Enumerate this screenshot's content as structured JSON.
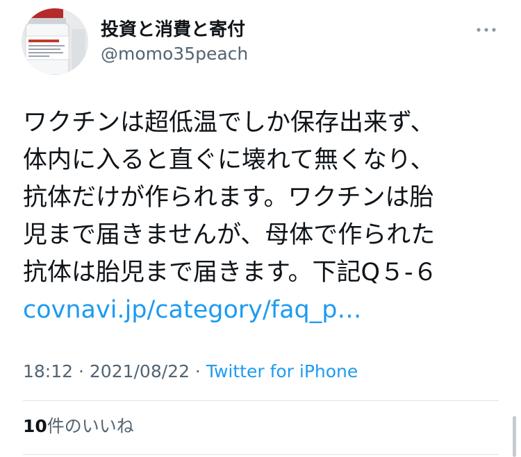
{
  "tweet": {
    "author": {
      "display_name": "投資と消費と寄付",
      "handle": "@momo35peach",
      "avatar": "vaccine-vial-photo"
    },
    "more_icon": "more-dots-icon",
    "text_lines": [
      "ワクチンは超低温でしか保存出来ず、",
      "体内に入ると直ぐに壊れて無くなり、",
      "抗体だけが作られます。ワクチンは胎",
      "児まで届きませんが、母体で作られた",
      "抗体は胎児まで届きます。下記Q５-６"
    ],
    "link": "covnavi.jp/category/faq_p…",
    "time": "18:12",
    "date": "2021/08/22",
    "separator": " · ",
    "source": "Twitter for iPhone",
    "likes": {
      "count": "10",
      "label": "件のいいね"
    }
  },
  "colors": {
    "text": "#0f1419",
    "secondary": "#536471",
    "link": "#1d9bf0",
    "divider": "#dfe3e6"
  }
}
